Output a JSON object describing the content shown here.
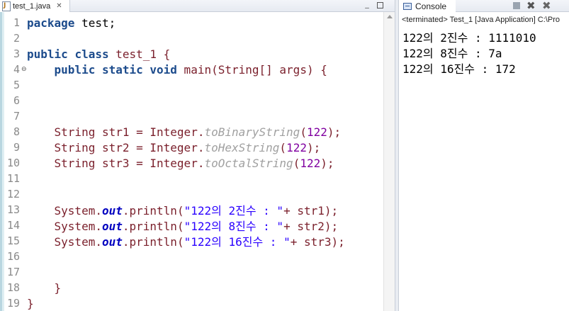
{
  "editor": {
    "tab_label": "test_1.java",
    "lines": [
      {
        "num": "1",
        "y": 0
      },
      {
        "num": "2"
      },
      {
        "num": "3"
      },
      {
        "num": "4"
      },
      {
        "num": "5"
      },
      {
        "num": "6"
      },
      {
        "num": "7"
      },
      {
        "num": "8"
      },
      {
        "num": "9"
      },
      {
        "num": "10"
      },
      {
        "num": "11"
      },
      {
        "num": "12"
      },
      {
        "num": "13"
      },
      {
        "num": "14"
      },
      {
        "num": "15"
      },
      {
        "num": "16"
      },
      {
        "num": "17"
      },
      {
        "num": "18"
      },
      {
        "num": "19"
      }
    ],
    "code": {
      "package_kw": "package",
      "package_name": " test;",
      "public_kw": "public",
      "class_kw": "class",
      "class_name": " test_1 {",
      "main_mods": "public static void",
      "main_sig": " main(String[] args) {",
      "string_type": "String",
      "str1_decl": " str1 = Integer.",
      "str2_decl": " str2 = Integer.",
      "str3_decl": " str3 = Integer.",
      "to_binary": "toBinaryString",
      "to_hex": "toHexString",
      "to_octal": "toOctalString",
      "arg_122": "122",
      "system_out": "System.",
      "out_field": "out",
      "println": ".println(",
      "lit1": "\"122의 2진수 : \"",
      "lit2": "\"122의 8진수 : \"",
      "lit3": "\"122의 16진수 : \"",
      "concat1": "+ str1);",
      "concat2": "+ str2);",
      "concat3": "+ str3);",
      "close_method": "}",
      "close_class": "}"
    }
  },
  "console": {
    "tab_label": "Console",
    "status": "<terminated> Test_1 [Java Application] C:\\Pro",
    "output": [
      "122의 2진수 : 1111010",
      "122의 8진수 : 7a",
      "122의 16진수 : 172"
    ]
  }
}
